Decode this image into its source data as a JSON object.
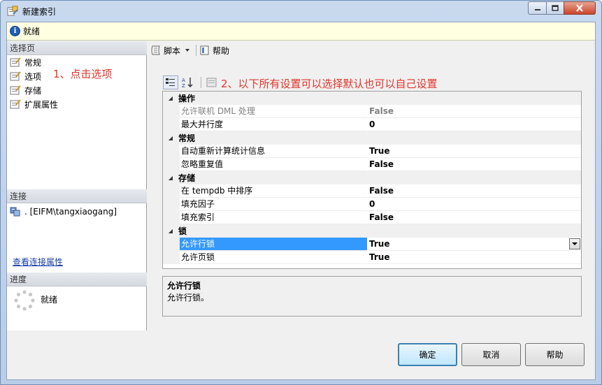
{
  "window": {
    "title": "新建索引"
  },
  "infobar": {
    "status": "就绪"
  },
  "left": {
    "select_page_header": "选择页",
    "pages": [
      {
        "label": "常规"
      },
      {
        "label": "选项"
      },
      {
        "label": "存储"
      },
      {
        "label": "扩展属性"
      }
    ],
    "annotation1": "1、点击选项",
    "connection_header": "连接",
    "connection_value": ". [EIFM\\tangxiaogang]",
    "connection_link": "查看连接属性",
    "progress_header": "进度",
    "progress_status": "就绪"
  },
  "toolbar": {
    "script_label": "脚本",
    "help_label": "帮助"
  },
  "annotation2": "2、以下所有设置可以选择默认也可以自己设置",
  "grid": {
    "categories": [
      {
        "name": "操作",
        "props": [
          {
            "name": "允许联机 DML 处理",
            "value": "False",
            "disabled": true
          },
          {
            "name": "最大并行度",
            "value": "0"
          }
        ]
      },
      {
        "name": "常规",
        "props": [
          {
            "name": "自动重新计算统计信息",
            "value": "True"
          },
          {
            "name": "忽略重复值",
            "value": "False"
          }
        ]
      },
      {
        "name": "存储",
        "props": [
          {
            "name": "在 tempdb 中排序",
            "value": "False"
          },
          {
            "name": "填充因子",
            "value": "0"
          },
          {
            "name": "填充索引",
            "value": "False"
          }
        ]
      },
      {
        "name": "锁",
        "props": [
          {
            "name": "允许行锁",
            "value": "True",
            "selected": true
          },
          {
            "name": "允许页锁",
            "value": "True"
          }
        ]
      }
    ]
  },
  "description": {
    "title": "允许行锁",
    "text": "允许行锁。"
  },
  "buttons": {
    "ok": "确定",
    "cancel": "取消",
    "help": "帮助"
  }
}
